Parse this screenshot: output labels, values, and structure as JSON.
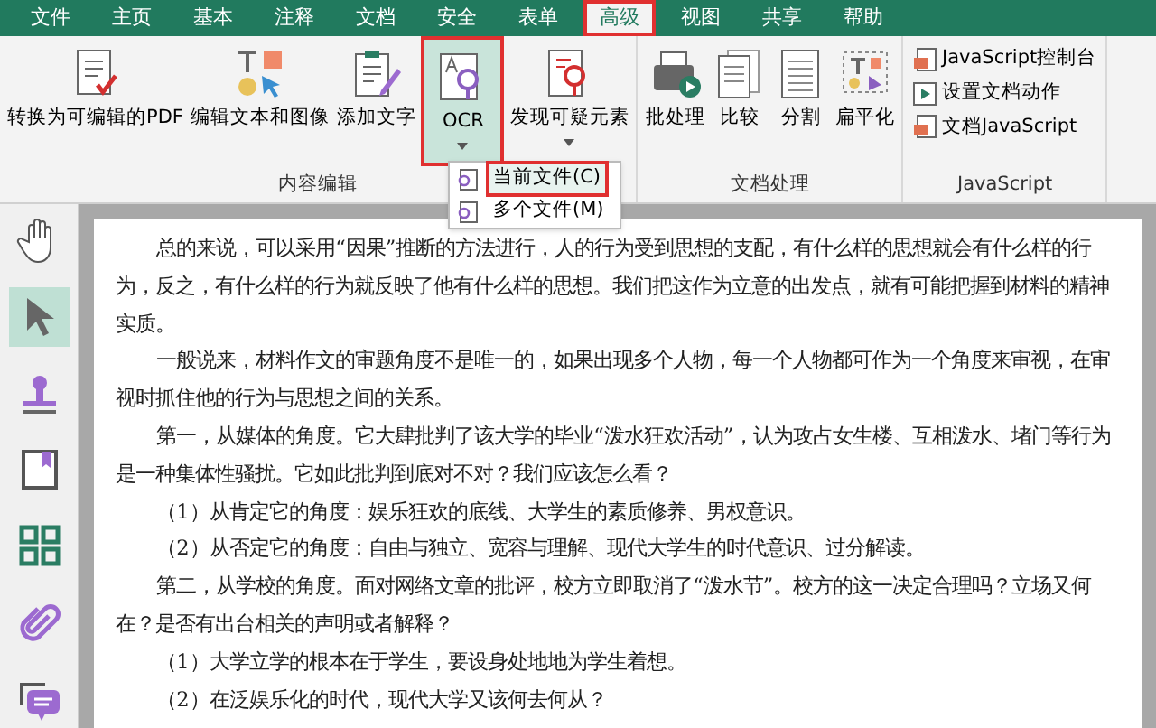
{
  "menu_tabs": [
    {
      "label": "文件",
      "selected": false
    },
    {
      "label": "主页",
      "selected": false
    },
    {
      "label": "基本",
      "selected": false
    },
    {
      "label": "注释",
      "selected": false
    },
    {
      "label": "文档",
      "selected": false
    },
    {
      "label": "安全",
      "selected": false
    },
    {
      "label": "表单",
      "selected": false
    },
    {
      "label": "高级",
      "selected": true
    },
    {
      "label": "视图",
      "selected": false
    },
    {
      "label": "共享",
      "selected": false
    },
    {
      "label": "帮助",
      "selected": false
    }
  ],
  "ribbon_groups": [
    {
      "label": "内容编辑",
      "buttons": [
        {
          "kind": "large",
          "label": "转换为可编辑的PDF",
          "selected": false,
          "has_dropdown": false
        },
        {
          "kind": "large",
          "label": "编辑文本和图像",
          "selected": false,
          "has_dropdown": false
        },
        {
          "kind": "large",
          "label": "添加文字",
          "selected": false,
          "has_dropdown": false
        },
        {
          "kind": "large",
          "label": "OCR",
          "selected": true,
          "has_dropdown": true
        },
        {
          "kind": "large",
          "label": "发现可疑元素",
          "selected": false,
          "has_dropdown": true
        }
      ]
    },
    {
      "label": "文档处理",
      "buttons": [
        {
          "kind": "large",
          "label": "批处理",
          "selected": false,
          "has_dropdown": false
        },
        {
          "kind": "large",
          "label": "比较",
          "selected": false,
          "has_dropdown": false
        },
        {
          "kind": "large",
          "label": "分割",
          "selected": false,
          "has_dropdown": false
        },
        {
          "kind": "large",
          "label": "扁平化",
          "selected": false,
          "has_dropdown": false
        }
      ]
    },
    {
      "label": "JavaScript",
      "buttons": [
        {
          "kind": "small",
          "label": "JavaScript控制台",
          "selected": false,
          "has_dropdown": false
        },
        {
          "kind": "small",
          "label": "设置文档动作",
          "selected": false,
          "has_dropdown": false
        },
        {
          "kind": "small",
          "label": "文档JavaScript",
          "selected": false,
          "has_dropdown": false
        }
      ]
    }
  ],
  "ocr_menu": [
    {
      "label": "当前文件(C)",
      "selected": true
    },
    {
      "label": "多个文件(M)",
      "selected": false
    }
  ],
  "tools": [
    {
      "selected": false
    },
    {
      "selected": true
    },
    {
      "selected": false
    },
    {
      "selected": false
    },
    {
      "selected": false
    },
    {
      "selected": false
    },
    {
      "selected": false
    }
  ],
  "document_paragraphs": [
    "总的来说，可以采用“因果”推断的方法进行，人的行为受到思想的支配，有什么样的思想就会有什么样的行为，反之，有什么样的行为就反映了他有什么样的思想。我们把这作为立意的出发点，就有可能把握到材料的精神实质。",
    "一般说来，材料作文的审题角度不是唯一的，如果出现多个人物，每一个人物都可作为一个角度来审视，在审视时抓住他的行为与思想之间的关系。",
    "第一，从媒体的角度。它大肆批判了该大学的毕业“泼水狂欢活动”，认为攻占女生楼、互相泼水、堵门等行为是一种集体性骚扰。它如此批判到底对不对？我们应该怎么看？",
    "（1）从肯定它的角度：娱乐狂欢的底线、大学生的素质修养、男权意识。",
    "（2）从否定它的角度：自由与独立、宽容与理解、现代大学生的时代意识、过分解读。",
    "第二，从学校的角度。面对网络文章的批评，校方立即取消了“泼水节”。校方的这一决定合理吗？立场又何在？是否有出台相关的声明或者解释？",
    "（1）大学立学的根本在于学生，要设身处地地为学生着想。",
    "（2）在泛娱乐化的时代，现代大学又该何去何从？"
  ]
}
